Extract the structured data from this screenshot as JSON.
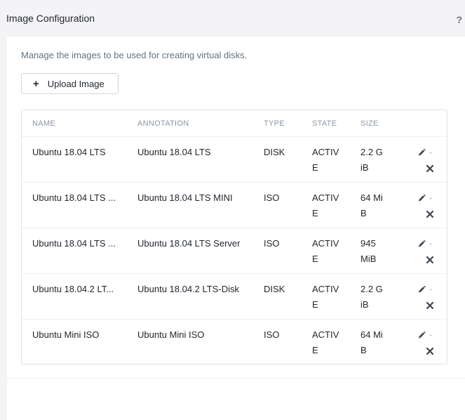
{
  "header": {
    "title": "Image Configuration",
    "help_label": "?"
  },
  "panel": {
    "description": "Manage the images to be used for creating virtual disks.",
    "upload_button": {
      "icon": "plus-icon",
      "icon_glyph": "+",
      "label": "Upload Image"
    }
  },
  "table": {
    "columns": {
      "name": "NAME",
      "annotation": "ANNOTATION",
      "type": "TYPE",
      "state": "STATE",
      "size": "SIZE"
    },
    "rows": [
      {
        "name": "Ubuntu 18.04 LTS",
        "annotation": "Ubuntu 18.04 LTS",
        "type": "DISK",
        "state": "ACTIVE",
        "size": "2.2 GiB"
      },
      {
        "name": "Ubuntu 18.04 LTS ...",
        "annotation": "Ubuntu 18.04 LTS MINI",
        "type": "ISO",
        "state": "ACTIVE",
        "size": "64 MiB"
      },
      {
        "name": "Ubuntu 18.04 LTS ...",
        "annotation": "Ubuntu 18.04 LTS Server",
        "type": "ISO",
        "state": "ACTIVE",
        "size": "945 MiB"
      },
      {
        "name": "Ubuntu 18.04.2 LT...",
        "annotation": "Ubuntu 18.04.2 LTS-Disk",
        "type": "DISK",
        "state": "ACTIVE",
        "size": "2.2 GiB"
      },
      {
        "name": "Ubuntu Mini ISO",
        "annotation": "Ubuntu Mini ISO",
        "type": "ISO",
        "state": "ACTIVE",
        "size": "64 MiB"
      }
    ],
    "row_actions": {
      "edit_icon": "pencil-icon",
      "delete_icon": "close-icon"
    }
  },
  "colors": {
    "background": "#f4f4f6",
    "panel": "#ffffff",
    "text": "#22272e",
    "muted": "#5f7486",
    "header_text": "#8a96a3",
    "border": "#dfe3e8"
  }
}
